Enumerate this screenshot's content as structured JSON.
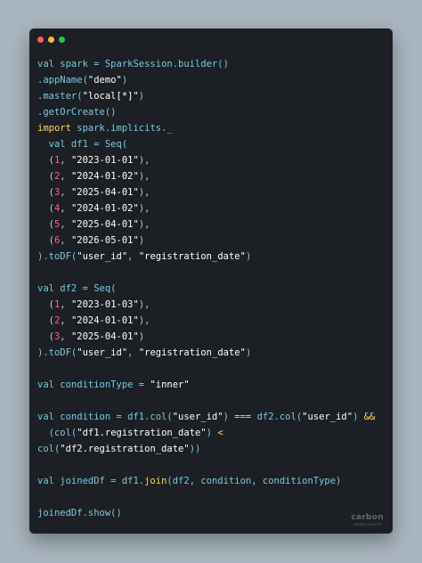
{
  "window": {
    "controls": [
      {
        "name": "close",
        "color": "#ff5f57"
      },
      {
        "name": "minimize",
        "color": "#febc2e"
      },
      {
        "name": "maximize",
        "color": "#28c840"
      }
    ]
  },
  "code": [
    [
      [
        "id",
        "val spark = SparkSession.builder()"
      ]
    ],
    [
      [
        "id",
        ".appName("
      ],
      [
        "str",
        "\"demo\""
      ],
      [
        "id",
        ")"
      ]
    ],
    [
      [
        "id",
        ".master("
      ],
      [
        "str",
        "\"local[*]\""
      ],
      [
        "id",
        ")"
      ]
    ],
    [
      [
        "id",
        ".getOrCreate()"
      ]
    ],
    [
      [
        "kw",
        "import"
      ],
      [
        "id",
        " spark.implicits._"
      ]
    ],
    [
      [
        "id",
        "  val df1 = Seq("
      ]
    ],
    [
      [
        "p",
        "  ("
      ],
      [
        "num",
        "1"
      ],
      [
        "p",
        ", "
      ],
      [
        "str",
        "\"2023-01-01\""
      ],
      [
        "p",
        "),"
      ]
    ],
    [
      [
        "p",
        "  ("
      ],
      [
        "num",
        "2"
      ],
      [
        "p",
        ", "
      ],
      [
        "str",
        "\"2024-01-02\""
      ],
      [
        "p",
        "),"
      ]
    ],
    [
      [
        "p",
        "  ("
      ],
      [
        "num",
        "3"
      ],
      [
        "p",
        ", "
      ],
      [
        "str",
        "\"2025-04-01\""
      ],
      [
        "p",
        "),"
      ]
    ],
    [
      [
        "p",
        "  ("
      ],
      [
        "num",
        "4"
      ],
      [
        "p",
        ", "
      ],
      [
        "str",
        "\"2024-01-02\""
      ],
      [
        "p",
        "),"
      ]
    ],
    [
      [
        "p",
        "  ("
      ],
      [
        "num",
        "5"
      ],
      [
        "p",
        ", "
      ],
      [
        "str",
        "\"2025-04-01\""
      ],
      [
        "p",
        "),"
      ]
    ],
    [
      [
        "p",
        "  ("
      ],
      [
        "num",
        "6"
      ],
      [
        "p",
        ", "
      ],
      [
        "str",
        "\"2026-05-01\""
      ],
      [
        "p",
        ")"
      ]
    ],
    [
      [
        "id",
        ").toDF("
      ],
      [
        "str",
        "\"user_id\""
      ],
      [
        "id",
        ", "
      ],
      [
        "str",
        "\"registration_date\""
      ],
      [
        "id",
        ")"
      ]
    ],
    [],
    [
      [
        "id",
        "val df2 = Seq("
      ]
    ],
    [
      [
        "p",
        "  ("
      ],
      [
        "num",
        "1"
      ],
      [
        "p",
        ", "
      ],
      [
        "str",
        "\"2023-01-03\""
      ],
      [
        "p",
        "),"
      ]
    ],
    [
      [
        "p",
        "  ("
      ],
      [
        "num",
        "2"
      ],
      [
        "p",
        ", "
      ],
      [
        "str",
        "\"2024-01-01\""
      ],
      [
        "p",
        "),"
      ]
    ],
    [
      [
        "p",
        "  ("
      ],
      [
        "num",
        "3"
      ],
      [
        "p",
        ", "
      ],
      [
        "str",
        "\"2025-04-01\""
      ],
      [
        "p",
        ")"
      ]
    ],
    [
      [
        "id",
        ").toDF("
      ],
      [
        "str",
        "\"user_id\""
      ],
      [
        "id",
        ", "
      ],
      [
        "str",
        "\"registration_date\""
      ],
      [
        "id",
        ")"
      ]
    ],
    [],
    [
      [
        "id",
        "val conditionType = "
      ],
      [
        "str",
        "\"inner\""
      ]
    ],
    [],
    [
      [
        "id",
        "val condition = df1.col("
      ],
      [
        "str",
        "\"user_id\""
      ],
      [
        "id",
        ") "
      ],
      [
        "op",
        "==="
      ],
      [
        "id",
        " df2.col("
      ],
      [
        "str",
        "\"user_id\""
      ],
      [
        "id",
        ") "
      ],
      [
        "op",
        "&&"
      ]
    ],
    [
      [
        "id",
        "  (col("
      ],
      [
        "str",
        "\"df1.registration_date\""
      ],
      [
        "id",
        ") "
      ],
      [
        "op",
        "<"
      ]
    ],
    [
      [
        "id",
        "col("
      ],
      [
        "str",
        "\"df2.registration_date\""
      ],
      [
        "id",
        "))"
      ]
    ],
    [],
    [
      [
        "id",
        "val joinedDf = df1."
      ],
      [
        "kw",
        "join"
      ],
      [
        "id",
        "(df2, condition, conditionType)"
      ]
    ],
    [],
    [
      [
        "id",
        "joinedDf.show()"
      ]
    ]
  ],
  "watermark": {
    "logo": "carbon",
    "subtitle": "carbon.now.sh"
  }
}
